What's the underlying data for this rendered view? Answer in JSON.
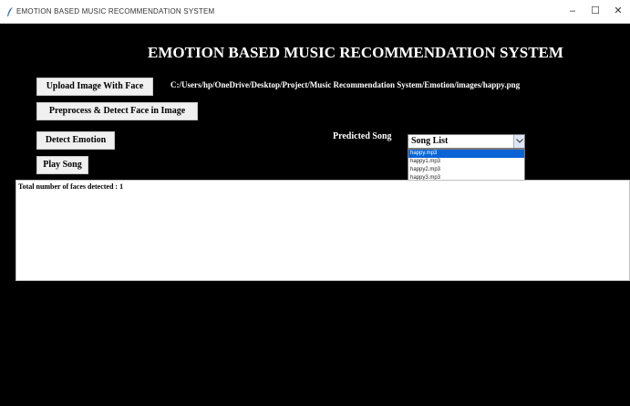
{
  "window": {
    "title": "EMOTION BASED MUSIC RECOMMENDATION SYSTEM",
    "controls": {
      "minimize": "–",
      "maximize": "☐",
      "close": "✕"
    },
    "icon": "feather-icon"
  },
  "header": {
    "title": "EMOTION BASED MUSIC RECOMMENDATION SYSTEM"
  },
  "buttons": {
    "upload": "Upload Image With Face",
    "preprocess": "Preprocess & Detect Face in Image",
    "detect": "Detect Emotion",
    "play": "Play Song"
  },
  "path_label": "C:/Users/hp/OneDrive/Desktop/Project/Music Recommendation System/Emotion/images/happy.png",
  "predicted_label": "Predicted Song",
  "song_combo": {
    "selected": "Song List",
    "options": [
      "happy.mp3",
      "happy1.mp3",
      "happy2.mp3",
      "happy3.mp3"
    ],
    "highlighted_index": 0
  },
  "output": {
    "text": "Total number of faces detected : 1"
  },
  "colors": {
    "background": "#000000",
    "button_bg": "#f0f0f0",
    "highlight": "#0a64d6"
  }
}
